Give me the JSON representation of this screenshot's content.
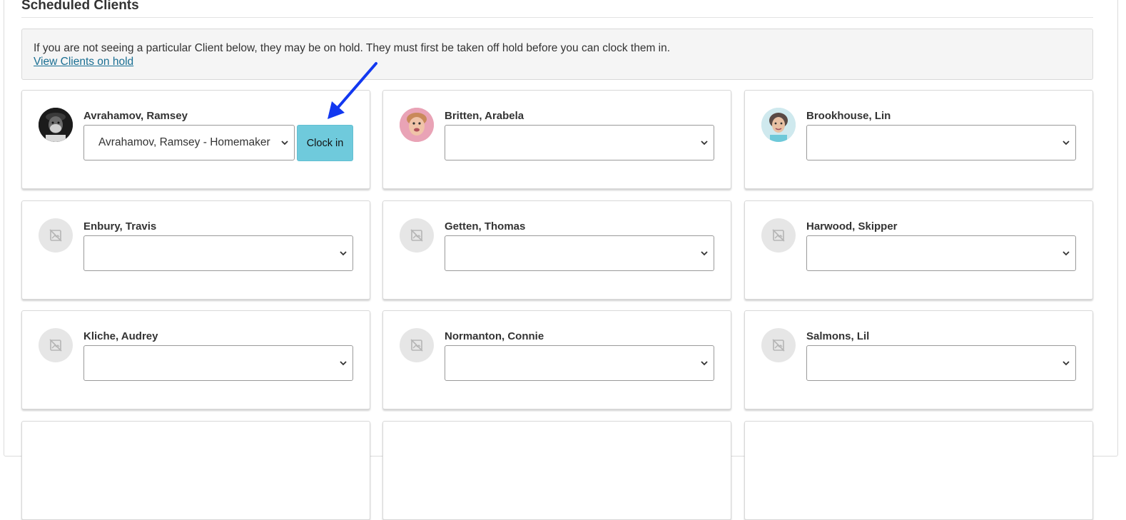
{
  "section": {
    "title": "Scheduled Clients"
  },
  "notice": {
    "text": "If you are not seeing a particular Client below, they may be on hold. They must first be taken off hold before you can clock them in.",
    "link": "View Clients on hold"
  },
  "clients": [
    {
      "name": "Avrahamov, Ramsey",
      "service": "Avrahamov, Ramsey - Homemaker",
      "button": "Clock in",
      "avatar": "photo-elderly-man"
    },
    {
      "name": "Britten, Arabela",
      "service": "",
      "avatar": "photo-elderly-woman"
    },
    {
      "name": "Brookhouse, Lin",
      "service": "",
      "avatar": "photo-woman"
    },
    {
      "name": "Enbury, Travis",
      "service": "",
      "avatar": "no-image-icon"
    },
    {
      "name": "Getten, Thomas",
      "service": "",
      "avatar": "no-image-icon"
    },
    {
      "name": "Harwood, Skipper",
      "service": "",
      "avatar": "no-image-icon"
    },
    {
      "name": "Kliche, Audrey",
      "service": "",
      "avatar": "no-image-icon"
    },
    {
      "name": "Normanton, Connie",
      "service": "",
      "avatar": "no-image-icon"
    },
    {
      "name": "Salmons, Lil",
      "service": "",
      "avatar": "no-image-icon"
    }
  ],
  "annotation": {
    "arrow_color": "#1238f0"
  },
  "colors": {
    "clock_button": "#6fcadc",
    "link": "#1a6f93"
  }
}
